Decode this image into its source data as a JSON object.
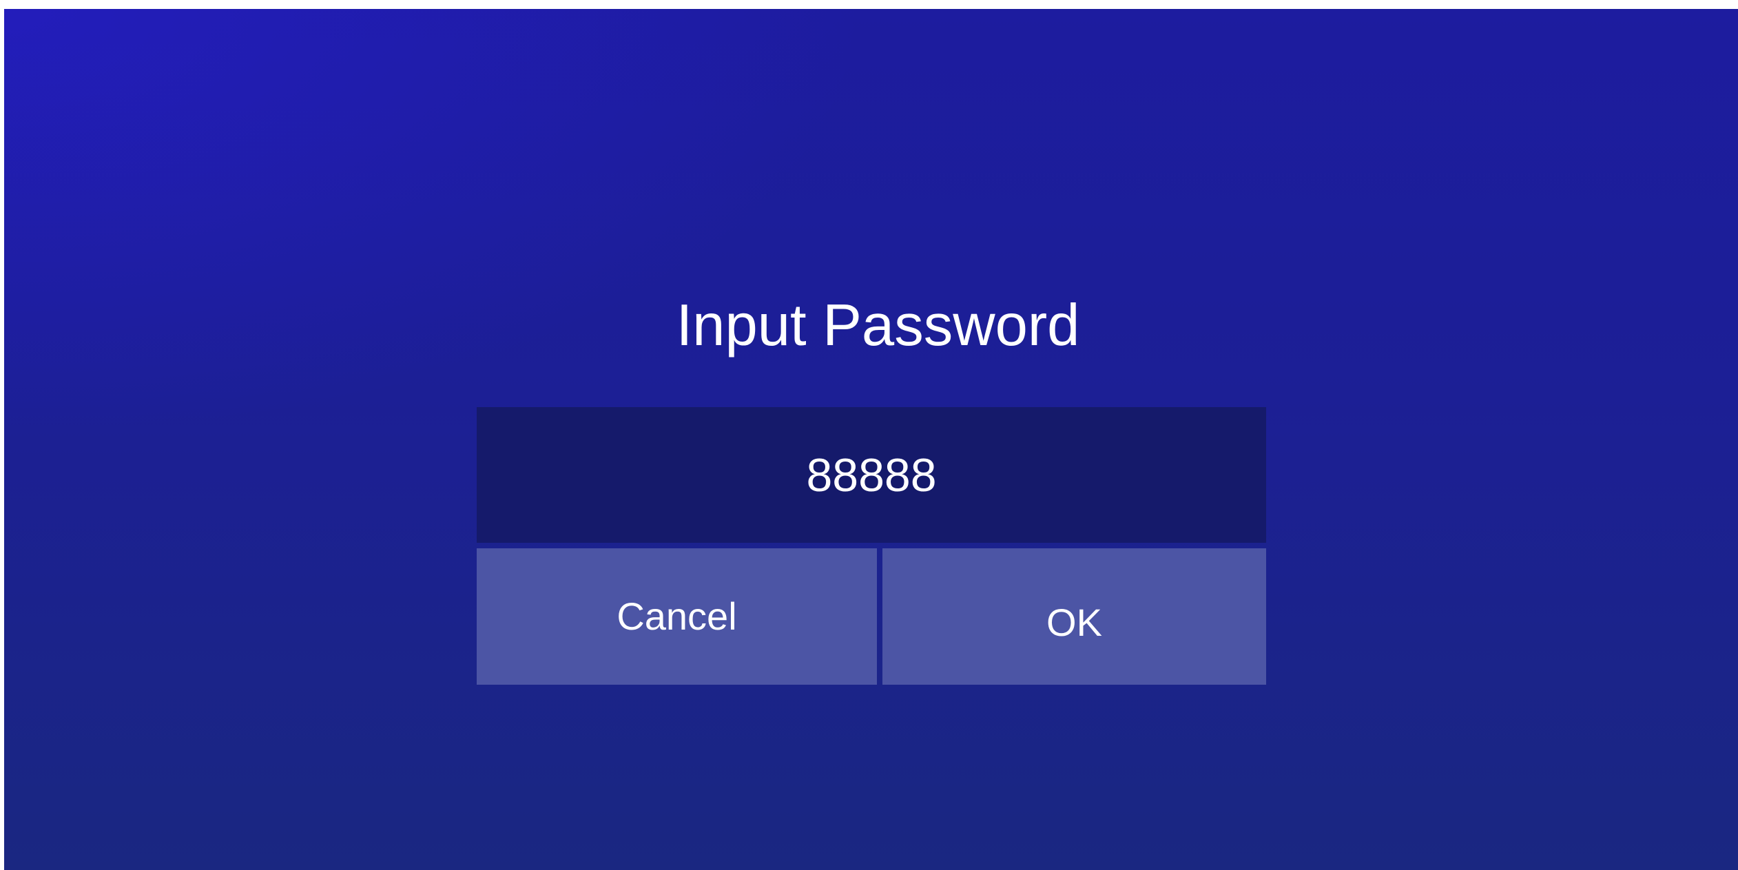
{
  "dialog": {
    "title": "Input Password",
    "password_value": "88888",
    "cancel_label": "Cancel",
    "ok_label": "OK"
  },
  "colors": {
    "background_top": "#1d1c9f",
    "background_bottom": "#1a2781",
    "field_background": "#151a6b",
    "button_background": "#4c55a5",
    "text": "#ffffff"
  }
}
